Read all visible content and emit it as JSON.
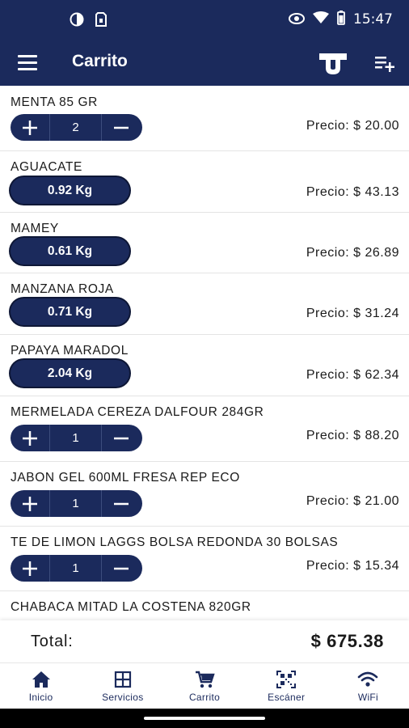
{
  "status_bar": {
    "time": "15:47"
  },
  "app_bar": {
    "title": "Carrito"
  },
  "items": [
    {
      "name": "MENTA  85 GR",
      "price": "Precio: $ 20.00",
      "type": "stepper",
      "quantity": "2"
    },
    {
      "name": "AGUACATE",
      "price": "Precio: $ 43.13",
      "type": "weight",
      "weight": "0.92 Kg"
    },
    {
      "name": "MAMEY",
      "price": "Precio: $ 26.89",
      "type": "weight",
      "weight": "0.61 Kg"
    },
    {
      "name": "MANZANA ROJA",
      "price": "Precio: $ 31.24",
      "type": "weight",
      "weight": "0.71 Kg"
    },
    {
      "name": "PAPAYA MARADOL",
      "price": "Precio: $ 62.34",
      "type": "weight",
      "weight": "2.04 Kg"
    },
    {
      "name": "MERMELADA CEREZA DALFOUR 284GR",
      "price": "Precio: $ 88.20",
      "type": "stepper",
      "quantity": "1"
    },
    {
      "name": "JABON GEL 600ML FRESA REP ECO",
      "price": "Precio: $ 21.00",
      "type": "stepper",
      "quantity": "1"
    },
    {
      "name": "TE DE LIMON LAGGS BOLSA REDONDA 30 BOLSAS",
      "price": "Precio: $ 15.34",
      "type": "stepper",
      "quantity": "1"
    },
    {
      "name": "CHABACA MITAD LA COSTENA 820GR",
      "type": "partial"
    }
  ],
  "total": {
    "label": "Total:",
    "value": "$ 675.38"
  },
  "bottom_nav": [
    {
      "label": "Inicio",
      "icon": "home-icon"
    },
    {
      "label": "Servicios",
      "icon": "grid-icon"
    },
    {
      "label": "Carrito",
      "icon": "cart-icon"
    },
    {
      "label": "Escáner",
      "icon": "qr-scan-icon"
    },
    {
      "label": "WiFi",
      "icon": "wifi-icon"
    }
  ],
  "colors": {
    "primary": "#1b2a5c",
    "text": "#1a1a1a",
    "background": "#ffffff"
  }
}
